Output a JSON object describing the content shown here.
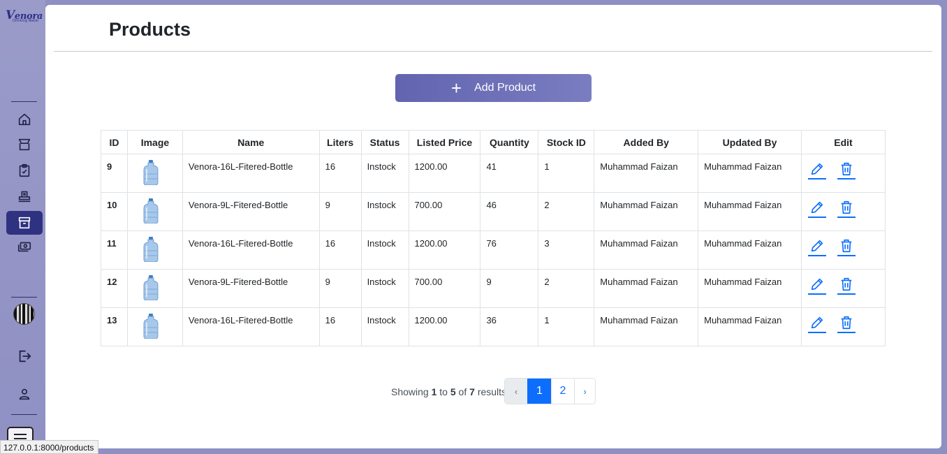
{
  "brand": {
    "name_first": "V",
    "name_rest": "enora",
    "tagline": "Drinking Water"
  },
  "sidebar": {
    "items": [
      {
        "name": "home",
        "icon": "home-icon"
      },
      {
        "name": "shop",
        "icon": "shop-icon"
      },
      {
        "name": "orders",
        "icon": "clipboard-check-icon"
      },
      {
        "name": "inventory",
        "icon": "inventory-icon"
      },
      {
        "name": "products",
        "icon": "archive-box-icon",
        "active": true
      },
      {
        "name": "payments",
        "icon": "money-icon"
      }
    ],
    "bottom": [
      "avatar",
      "logout-icon",
      "user-icon",
      "menu-icon"
    ]
  },
  "page": {
    "title": "Products"
  },
  "toolbar": {
    "add_label": "Add Product"
  },
  "table": {
    "headers": [
      "ID",
      "Image",
      "Name",
      "Liters",
      "Status",
      "Listed Price",
      "Quantity",
      "Stock ID",
      "Added By",
      "Updated By",
      "Edit"
    ],
    "rows": [
      {
        "id": "9",
        "name": "Venora-16L-Fitered-Bottle",
        "liters": "16",
        "status": "Instock",
        "price": "1200.00",
        "quantity": "41",
        "stock_id": "1",
        "added_by": "Muhammad Faizan",
        "updated_by": "Muhammad Faizan"
      },
      {
        "id": "10",
        "name": "Venora-9L-Fitered-Bottle",
        "liters": "9",
        "status": "Instock",
        "price": "700.00",
        "quantity": "46",
        "stock_id": "2",
        "added_by": "Muhammad Faizan",
        "updated_by": "Muhammad Faizan"
      },
      {
        "id": "11",
        "name": "Venora-16L-Fitered-Bottle",
        "liters": "16",
        "status": "Instock",
        "price": "1200.00",
        "quantity": "76",
        "stock_id": "3",
        "added_by": "Muhammad Faizan",
        "updated_by": "Muhammad Faizan"
      },
      {
        "id": "12",
        "name": "Venora-9L-Fitered-Bottle",
        "liters": "9",
        "status": "Instock",
        "price": "700.00",
        "quantity": "9",
        "stock_id": "2",
        "added_by": "Muhammad Faizan",
        "updated_by": "Muhammad Faizan"
      },
      {
        "id": "13",
        "name": "Venora-16L-Fitered-Bottle",
        "liters": "16",
        "status": "Instock",
        "price": "1200.00",
        "quantity": "36",
        "stock_id": "1",
        "added_by": "Muhammad Faizan",
        "updated_by": "Muhammad Faizan"
      }
    ]
  },
  "pagination": {
    "showing": "Showing",
    "from": "1",
    "to_word": "to",
    "to": "5",
    "of_word": "of",
    "total": "7",
    "results_word": "results",
    "prev": "‹",
    "pages": [
      "1",
      "2"
    ],
    "current": "1",
    "next": "›"
  },
  "status_bar": {
    "url": "127.0.0.1:8000/products"
  },
  "colors": {
    "accent": "#0d6efd",
    "sidebar": "#9293c5",
    "active_nav": "#2e3280",
    "add_button": "#6a6cb7"
  }
}
